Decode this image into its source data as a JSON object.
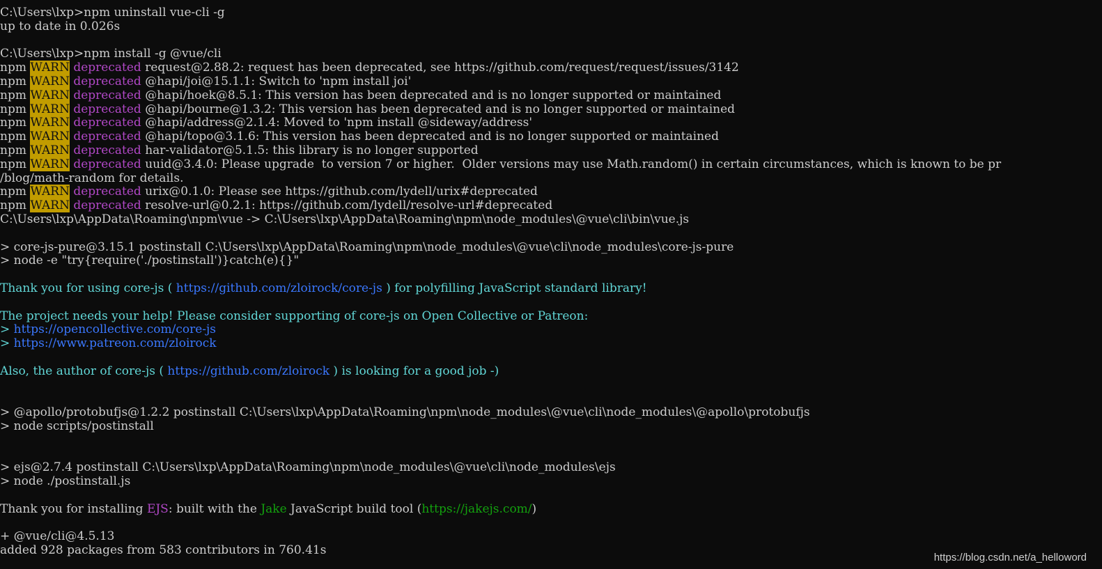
{
  "terminal": {
    "background": "#0c0c0c",
    "colors": {
      "default": "#cccccc",
      "warn_bg": "#c19c00",
      "deprecated": "#b148c6",
      "cyan": "#3a96dd",
      "teal": "#61d6d6",
      "link": "#3b78ff",
      "green": "#13a10e"
    },
    "lines": [
      [
        {
          "t": "C:\\Users\\lxp>npm uninstall vue-cli -g",
          "c": "default"
        }
      ],
      [
        {
          "t": "up to date in 0.026s",
          "c": "default"
        }
      ],
      [
        {
          "t": "",
          "c": "default"
        }
      ],
      [
        {
          "t": "C:\\Users\\lxp>npm install -g @vue/cli",
          "c": "default"
        }
      ],
      [
        {
          "t": "npm ",
          "c": "default"
        },
        {
          "t": "WARN",
          "c": "warn"
        },
        {
          "t": " ",
          "c": "default"
        },
        {
          "t": "deprecated",
          "c": "dep"
        },
        {
          "t": " request@2.88.2: request has been deprecated, see https://github.com/request/request/issues/3142",
          "c": "default"
        }
      ],
      [
        {
          "t": "npm ",
          "c": "default"
        },
        {
          "t": "WARN",
          "c": "warn"
        },
        {
          "t": " ",
          "c": "default"
        },
        {
          "t": "deprecated",
          "c": "dep"
        },
        {
          "t": " @hapi/joi@15.1.1: Switch to 'npm install joi'",
          "c": "default"
        }
      ],
      [
        {
          "t": "npm ",
          "c": "default"
        },
        {
          "t": "WARN",
          "c": "warn"
        },
        {
          "t": " ",
          "c": "default"
        },
        {
          "t": "deprecated",
          "c": "dep"
        },
        {
          "t": " @hapi/hoek@8.5.1: This version has been deprecated and is no longer supported or maintained",
          "c": "default"
        }
      ],
      [
        {
          "t": "npm ",
          "c": "default"
        },
        {
          "t": "WARN",
          "c": "warn"
        },
        {
          "t": " ",
          "c": "default"
        },
        {
          "t": "deprecated",
          "c": "dep"
        },
        {
          "t": " @hapi/bourne@1.3.2: This version has been deprecated and is no longer supported or maintained",
          "c": "default"
        }
      ],
      [
        {
          "t": "npm ",
          "c": "default"
        },
        {
          "t": "WARN",
          "c": "warn"
        },
        {
          "t": " ",
          "c": "default"
        },
        {
          "t": "deprecated",
          "c": "dep"
        },
        {
          "t": " @hapi/address@2.1.4: Moved to 'npm install @sideway/address'",
          "c": "default"
        }
      ],
      [
        {
          "t": "npm ",
          "c": "default"
        },
        {
          "t": "WARN",
          "c": "warn"
        },
        {
          "t": " ",
          "c": "default"
        },
        {
          "t": "deprecated",
          "c": "dep"
        },
        {
          "t": " @hapi/topo@3.1.6: This version has been deprecated and is no longer supported or maintained",
          "c": "default"
        }
      ],
      [
        {
          "t": "npm ",
          "c": "default"
        },
        {
          "t": "WARN",
          "c": "warn"
        },
        {
          "t": " ",
          "c": "default"
        },
        {
          "t": "deprecated",
          "c": "dep"
        },
        {
          "t": " har-validator@5.1.5: this library is no longer supported",
          "c": "default"
        }
      ],
      [
        {
          "t": "npm ",
          "c": "default"
        },
        {
          "t": "WARN",
          "c": "warn"
        },
        {
          "t": " ",
          "c": "default"
        },
        {
          "t": "deprecated",
          "c": "dep"
        },
        {
          "t": " uuid@3.4.0: Please upgrade  to version 7 or higher.  Older versions may use Math.random() in certain circumstances, which is known to be pr",
          "c": "default"
        }
      ],
      [
        {
          "t": "/blog/math-random for details.",
          "c": "default"
        }
      ],
      [
        {
          "t": "npm ",
          "c": "default"
        },
        {
          "t": "WARN",
          "c": "warn"
        },
        {
          "t": " ",
          "c": "default"
        },
        {
          "t": "deprecated",
          "c": "dep"
        },
        {
          "t": " urix@0.1.0: Please see https://github.com/lydell/urix#deprecated",
          "c": "default"
        }
      ],
      [
        {
          "t": "npm ",
          "c": "default"
        },
        {
          "t": "WARN",
          "c": "warn"
        },
        {
          "t": " ",
          "c": "default"
        },
        {
          "t": "deprecated",
          "c": "dep"
        },
        {
          "t": " resolve-url@0.2.1: https://github.com/lydell/resolve-url#deprecated",
          "c": "default"
        }
      ],
      [
        {
          "t": "C:\\Users\\lxp\\AppData\\Roaming\\npm\\vue -> C:\\Users\\lxp\\AppData\\Roaming\\npm\\node_modules\\@vue\\cli\\bin\\vue.js",
          "c": "default"
        }
      ],
      [
        {
          "t": "",
          "c": "default"
        }
      ],
      [
        {
          "t": "> core-js-pure@3.15.1 postinstall C:\\Users\\lxp\\AppData\\Roaming\\npm\\node_modules\\@vue\\cli\\node_modules\\core-js-pure",
          "c": "default"
        }
      ],
      [
        {
          "t": "> node -e \"try{require('./postinstall')}catch(e){}\"",
          "c": "default"
        }
      ],
      [
        {
          "t": "",
          "c": "default"
        }
      ],
      [
        {
          "t": "Thank you for using core-js ( ",
          "c": "teal"
        },
        {
          "t": "https://github.com/zloirock/core-js",
          "c": "link"
        },
        {
          "t": " ) for polyfilling JavaScript standard library!",
          "c": "teal"
        }
      ],
      [
        {
          "t": "",
          "c": "default"
        }
      ],
      [
        {
          "t": "The project needs your help! Please consider supporting of core-js on Open Collective or Patreon:",
          "c": "teal"
        }
      ],
      [
        {
          "t": "> ",
          "c": "teal"
        },
        {
          "t": "https://opencollective.com/core-js",
          "c": "link"
        }
      ],
      [
        {
          "t": "> ",
          "c": "teal"
        },
        {
          "t": "https://www.patreon.com/zloirock",
          "c": "link"
        }
      ],
      [
        {
          "t": "",
          "c": "default"
        }
      ],
      [
        {
          "t": "Also, the author of core-js ( ",
          "c": "teal"
        },
        {
          "t": "https://github.com/zloirock",
          "c": "link"
        },
        {
          "t": " ) is looking for a good job -)",
          "c": "teal"
        }
      ],
      [
        {
          "t": "",
          "c": "default"
        }
      ],
      [
        {
          "t": "",
          "c": "default"
        }
      ],
      [
        {
          "t": "> @apollo/protobufjs@1.2.2 postinstall C:\\Users\\lxp\\AppData\\Roaming\\npm\\node_modules\\@vue\\cli\\node_modules\\@apollo\\protobufjs",
          "c": "default"
        }
      ],
      [
        {
          "t": "> node scripts/postinstall",
          "c": "default"
        }
      ],
      [
        {
          "t": "",
          "c": "default"
        }
      ],
      [
        {
          "t": "",
          "c": "default"
        }
      ],
      [
        {
          "t": "> ejs@2.7.4 postinstall C:\\Users\\lxp\\AppData\\Roaming\\npm\\node_modules\\@vue\\cli\\node_modules\\ejs",
          "c": "default"
        }
      ],
      [
        {
          "t": "> node ./postinstall.js",
          "c": "default"
        }
      ],
      [
        {
          "t": "",
          "c": "default"
        }
      ],
      [
        {
          "t": "Thank you for installing ",
          "c": "default"
        },
        {
          "t": "EJS",
          "c": "purple"
        },
        {
          "t": ": built with the ",
          "c": "default"
        },
        {
          "t": "Jake",
          "c": "green"
        },
        {
          "t": " JavaScript build tool (",
          "c": "default"
        },
        {
          "t": "https://jakejs.com/",
          "c": "green"
        },
        {
          "t": ")",
          "c": "default"
        }
      ],
      [
        {
          "t": "",
          "c": "default"
        }
      ],
      [
        {
          "t": "+ @vue/cli@4.5.13",
          "c": "default"
        }
      ],
      [
        {
          "t": "added 928 packages from 583 contributors in 760.41s",
          "c": "default"
        }
      ]
    ]
  },
  "watermark": {
    "text": "https://blog.csdn.net/a_helloword"
  }
}
